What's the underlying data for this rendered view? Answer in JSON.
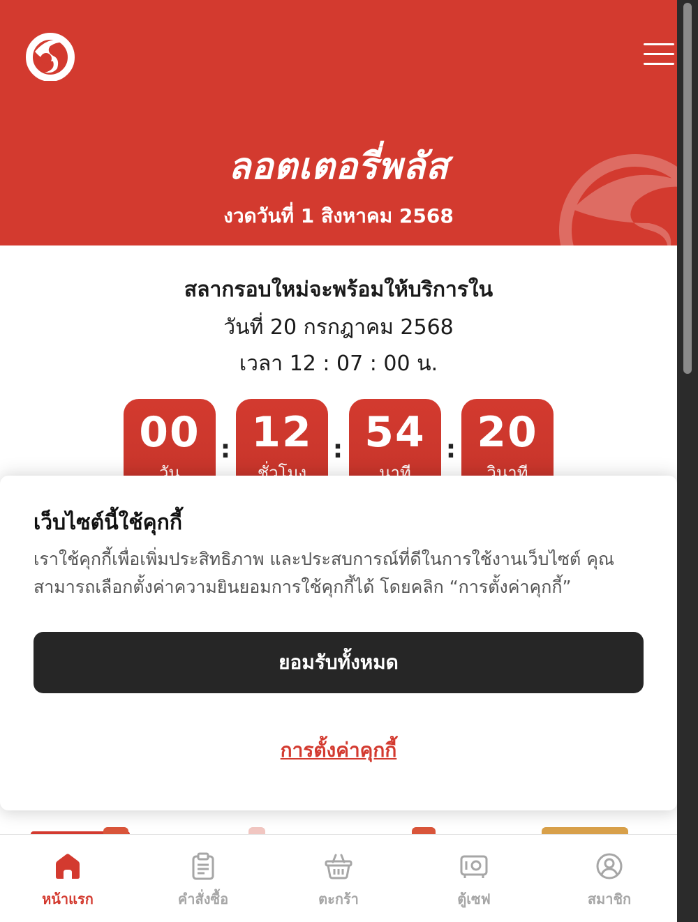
{
  "header": {
    "brand": "ลอตเตอรี่พลัส",
    "draw_date": "งวดวันที่  1 สิงหาคม 2568"
  },
  "next_round": {
    "title": "สลากรอบใหม่จะพร้อมให้บริการใน",
    "date": "วันที่ 20 กรกฎาคม 2568",
    "time": "เวลา 12 : 07 : 00 น."
  },
  "countdown": {
    "separator": ":",
    "items": [
      {
        "value": "00",
        "label": "วัน"
      },
      {
        "value": "12",
        "label": "ชั่วโมง"
      },
      {
        "value": "54",
        "label": "นาที"
      },
      {
        "value": "20",
        "label": "วินาที"
      }
    ]
  },
  "cookie": {
    "title": "เว็บไซต์นี้ใช้คุกกี้",
    "text": "เราใช้คุกกี้เพื่อเพิ่มประสิทธิภาพ และประสบการณ์ที่ดีในการใช้งานเว็บไซต์ คุณสามารถเลือกตั้งค่าความยินยอมการใช้คุกกี้ได้ โดยคลิก “การตั้งค่าคุกกี้”",
    "accept_label": "ยอมรับทั้งหมด",
    "settings_label": "การตั้งค่าคุกกี้"
  },
  "nav": {
    "items": [
      {
        "label": "หน้าแรก",
        "icon": "home-icon",
        "active": true
      },
      {
        "label": "คำสั่งซื้อ",
        "icon": "clipboard-icon",
        "active": false
      },
      {
        "label": "ตะกร้า",
        "icon": "basket-icon",
        "active": false
      },
      {
        "label": "ตู้เซฟ",
        "icon": "safe-icon",
        "active": false
      },
      {
        "label": "สมาชิก",
        "icon": "user-icon",
        "active": false
      }
    ]
  },
  "colors": {
    "brand_red": "#d33a2f",
    "dark_button": "#262626",
    "inactive_nav": "#a6a6a6"
  }
}
